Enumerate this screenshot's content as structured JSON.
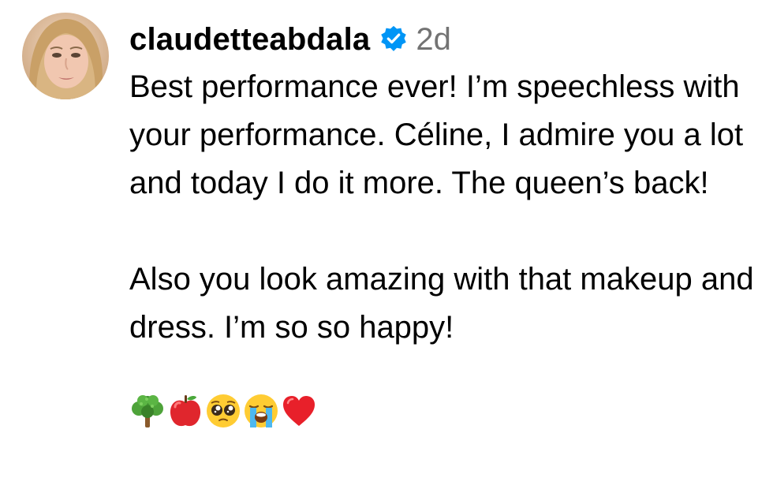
{
  "comment": {
    "username": "claudetteabdala",
    "verified": true,
    "timestamp": "2d",
    "paragraphs": [
      "Best performance ever! I’m speechless with your performance. Céline, I admire you a lot and today I do it more. The queen’s back!",
      "Also you look amazing with that makeup and dress. I’m so so happy!"
    ],
    "emojis": [
      {
        "name": "broccoli-tree-emoji",
        "glyph": "🌳"
      },
      {
        "name": "red-apple-emoji",
        "glyph": "🍎"
      },
      {
        "name": "pleading-face-emoji",
        "glyph": "🥺"
      },
      {
        "name": "loudly-crying-face-emoji",
        "glyph": "😭"
      },
      {
        "name": "red-heart-emoji",
        "glyph": "❤️"
      }
    ]
  },
  "colors": {
    "verified_badge": "#0095F6",
    "timestamp": "#737373",
    "text": "#000000"
  }
}
